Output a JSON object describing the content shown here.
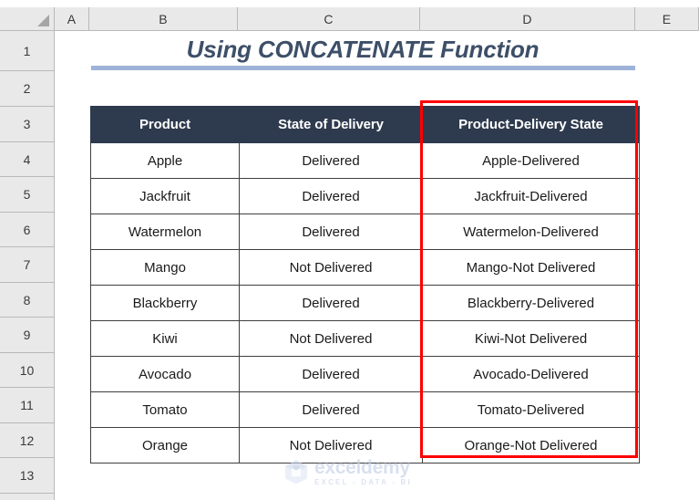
{
  "spreadsheet": {
    "column_headers": [
      "A",
      "B",
      "C",
      "D",
      "E"
    ],
    "row_headers": [
      "1",
      "2",
      "3",
      "4",
      "5",
      "6",
      "7",
      "8",
      "9",
      "10",
      "11",
      "12",
      "13"
    ],
    "select_all_icon": "select-all-triangle"
  },
  "title": {
    "text": "Using CONCATENATE Function",
    "color": "#3d4f68",
    "underline_color": "#9fb3d9"
  },
  "table": {
    "header_bg": "#2e3a4d",
    "header_text_color": "#ffffff",
    "columns": [
      "Product",
      "State of Delivery",
      "Product-Delivery State"
    ],
    "rows": [
      {
        "product": "Apple",
        "state": "Delivered",
        "combined": "Apple-Delivered"
      },
      {
        "product": "Jackfruit",
        "state": "Delivered",
        "combined": "Jackfruit-Delivered"
      },
      {
        "product": "Watermelon",
        "state": "Delivered",
        "combined": "Watermelon-Delivered"
      },
      {
        "product": "Mango",
        "state": "Not Delivered",
        "combined": "Mango-Not Delivered"
      },
      {
        "product": "Blackberry",
        "state": "Delivered",
        "combined": "Blackberry-Delivered"
      },
      {
        "product": "Kiwi",
        "state": "Not Delivered",
        "combined": "Kiwi-Not Delivered"
      },
      {
        "product": "Avocado",
        "state": "Delivered",
        "combined": "Avocado-Delivered"
      },
      {
        "product": "Tomato",
        "state": "Delivered",
        "combined": "Tomato-Delivered"
      },
      {
        "product": "Orange",
        "state": "Not Delivered",
        "combined": "Orange-Not Delivered"
      }
    ]
  },
  "highlight": {
    "name": "result-column-highlight",
    "color": "#fd0000"
  },
  "watermark": {
    "name": "exceldemy",
    "tagline": "EXCEL - DATA - BI",
    "logo_icon": "exceldemy-cube-logo"
  }
}
